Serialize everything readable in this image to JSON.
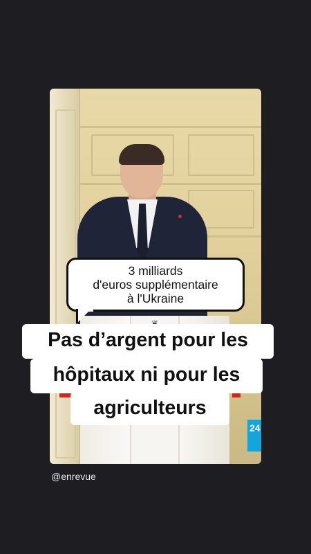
{
  "video": {
    "bubble": {
      "line1": "3 milliards",
      "line2": "d'euros supplémentaire",
      "line3": "à l'Ukraine"
    },
    "caption": {
      "line1": "Pas d’argent pour les",
      "line2": "hôpitaux ni pour les",
      "line3": "agriculteurs"
    },
    "channel_logo": "24"
  },
  "footer": {
    "handle": "@enrevue"
  },
  "colors": {
    "background": "#1e1d21",
    "caption_bg": "#ffffff",
    "logo_blue": "#13a6dd"
  }
}
